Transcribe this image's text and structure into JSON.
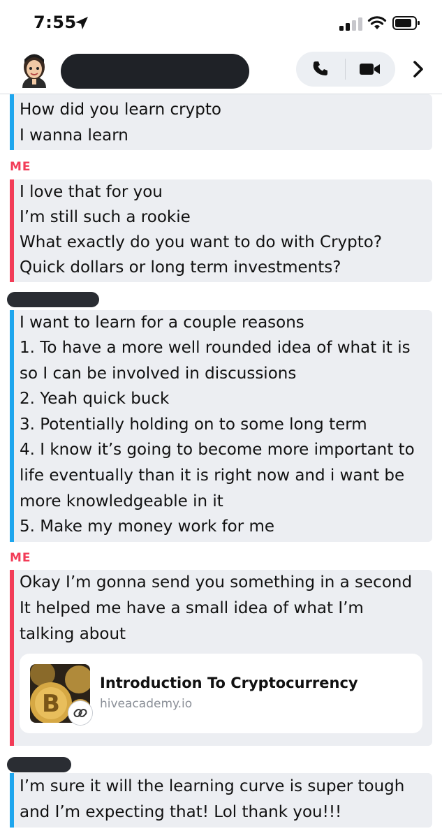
{
  "status_bar": {
    "time": "7:55",
    "icons": [
      "location-arrow-icon",
      "cellular-signal-icon",
      "wifi-icon",
      "battery-icon"
    ]
  },
  "header": {
    "contact_name": "",
    "icons": [
      "avatar",
      "phone-icon",
      "video-camera-icon",
      "chevron-right-icon"
    ]
  },
  "messages": [
    {
      "sender": "",
      "side": "friend",
      "lines": [
        "How did you learn crypto",
        "I wanna learn"
      ]
    },
    {
      "sender": "ME",
      "side": "me",
      "lines": [
        "I love that for you",
        "I’m still such a rookie",
        "What exactly do you want to do with Crypto?",
        "Quick dollars or long term investments?"
      ]
    },
    {
      "sender": "",
      "side": "friend",
      "lines": [
        "I want to learn for a couple reasons",
        "1. To have a more well rounded idea of what it is",
        "so I can be involved in discussions",
        "2. Yeah quick buck",
        "3. Potentially holding on to some long term",
        "4. I know it’s going to become more important to",
        "life eventually than it is right now and i want be",
        "more knowledgeable in it",
        "5. Make my money work for me"
      ]
    },
    {
      "sender": "ME",
      "side": "me",
      "lines": [
        "Okay I’m gonna send you something in a second",
        "It helped me have a small idea of what I’m",
        "talking about"
      ],
      "link": {
        "title": "Introduction To Cryptocurrency",
        "domain": "hiveacademy.io",
        "icon": "link-icon"
      }
    },
    {
      "sender": "",
      "side": "friend",
      "lines": [
        "I’m sure it will the learning curve is super tough",
        "and I’m expecting that! Lol thank you!!!"
      ]
    }
  ],
  "colors": {
    "me_accent": "#f23c57",
    "friend_accent": "#1ea6ee",
    "bubble_bg": "#eceef2",
    "redaction": "#1f2227"
  }
}
